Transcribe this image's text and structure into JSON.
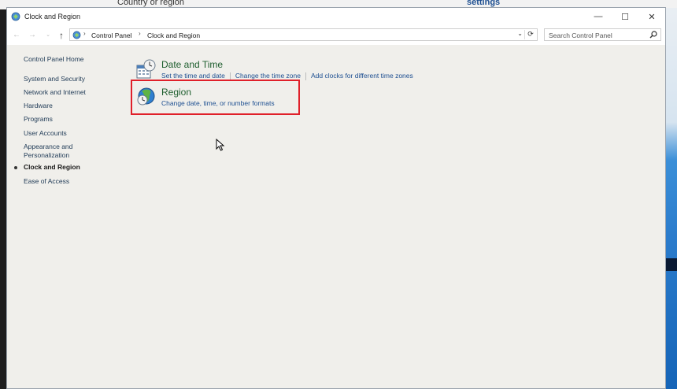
{
  "background": {
    "left_text": "Country or region",
    "right_text": "settings"
  },
  "window": {
    "title": "Clock and Region",
    "controls": {
      "minimize": "—",
      "maximize": "☐",
      "close": "✕"
    }
  },
  "nav": {
    "back": "←",
    "forward": "→",
    "recent": "⌄",
    "up": "↑",
    "breadcrumb": [
      "Control Panel",
      "Clock and Region"
    ],
    "search_placeholder": "Search Control Panel"
  },
  "sidebar": {
    "home": "Control Panel Home",
    "items": [
      {
        "label": "System and Security"
      },
      {
        "label": "Network and Internet"
      },
      {
        "label": "Hardware"
      },
      {
        "label": "Programs"
      },
      {
        "label": "User Accounts"
      },
      {
        "label": "Appearance and"
      },
      {
        "label": "Personalization"
      },
      {
        "label": "Clock and Region",
        "current": true
      },
      {
        "label": "Ease of Access"
      }
    ]
  },
  "categories": [
    {
      "title": "Date and Time",
      "icon": "clock-calendar-icon",
      "links": [
        "Set the time and date",
        "Change the time zone",
        "Add clocks for different time zones"
      ]
    },
    {
      "title": "Region",
      "icon": "globe-clock-icon",
      "links": [
        "Change date, time, or number formats"
      ]
    }
  ],
  "colors": {
    "highlight": "#e0202a",
    "link": "#1d4f91",
    "category_title": "#1e5e2e"
  }
}
